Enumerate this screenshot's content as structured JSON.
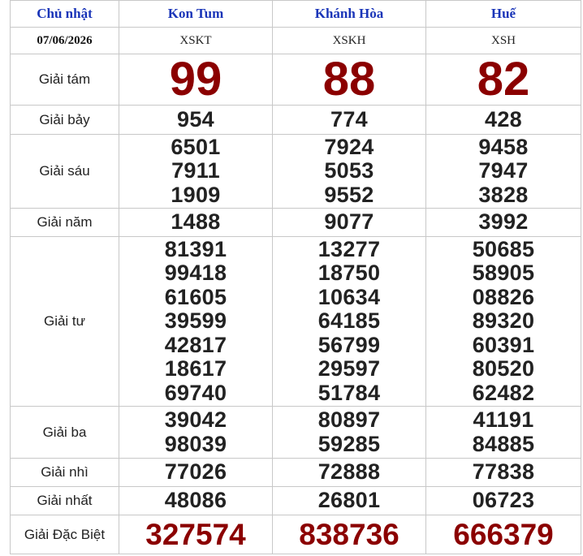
{
  "header": {
    "day": "Chủ nhật",
    "date": "07/06/2026",
    "provinces": [
      {
        "name": "Kon Tum",
        "code": "XSKT"
      },
      {
        "name": "Khánh Hòa",
        "code": "XSKH"
      },
      {
        "name": "Huế",
        "code": "XSH"
      }
    ]
  },
  "prizes": [
    {
      "label": "Giải tám",
      "values": [
        [
          "99"
        ],
        [
          "88"
        ],
        [
          "82"
        ]
      ]
    },
    {
      "label": "Giải bảy",
      "values": [
        [
          "954"
        ],
        [
          "774"
        ],
        [
          "428"
        ]
      ]
    },
    {
      "label": "Giải sáu",
      "values": [
        [
          "6501",
          "7911",
          "1909"
        ],
        [
          "7924",
          "5053",
          "9552"
        ],
        [
          "9458",
          "7947",
          "3828"
        ]
      ]
    },
    {
      "label": "Giải năm",
      "values": [
        [
          "1488"
        ],
        [
          "9077"
        ],
        [
          "3992"
        ]
      ]
    },
    {
      "label": "Giải tư",
      "values": [
        [
          "81391",
          "99418",
          "61605",
          "39599",
          "42817",
          "18617",
          "69740"
        ],
        [
          "13277",
          "18750",
          "10634",
          "64185",
          "56799",
          "29597",
          "51784"
        ],
        [
          "50685",
          "58905",
          "08826",
          "89320",
          "60391",
          "80520",
          "62482"
        ]
      ]
    },
    {
      "label": "Giải ba",
      "values": [
        [
          "39042",
          "98039"
        ],
        [
          "80897",
          "59285"
        ],
        [
          "41191",
          "84885"
        ]
      ]
    },
    {
      "label": "Giải nhì",
      "values": [
        [
          "77026"
        ],
        [
          "72888"
        ],
        [
          "77838"
        ]
      ]
    },
    {
      "label": "Giải nhất",
      "values": [
        [
          "48086"
        ],
        [
          "26801"
        ],
        [
          "06723"
        ]
      ]
    },
    {
      "label": "Giải Đặc Biệt",
      "values": [
        [
          "327574"
        ],
        [
          "838736"
        ],
        [
          "666379"
        ]
      ]
    }
  ]
}
